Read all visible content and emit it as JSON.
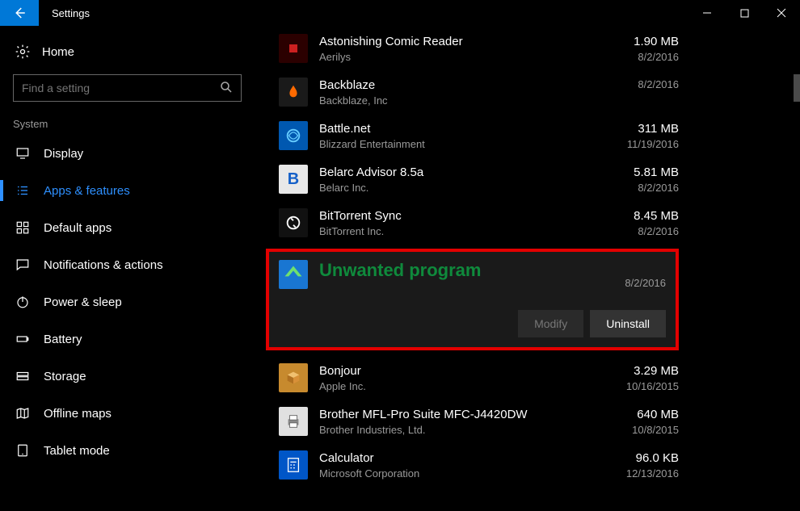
{
  "window": {
    "title": "Settings"
  },
  "sidebar": {
    "home_label": "Home",
    "search_placeholder": "Find a setting",
    "group_label": "System",
    "items": [
      {
        "label": "Display"
      },
      {
        "label": "Apps & features"
      },
      {
        "label": "Default apps"
      },
      {
        "label": "Notifications & actions"
      },
      {
        "label": "Power & sleep"
      },
      {
        "label": "Battery"
      },
      {
        "label": "Storage"
      },
      {
        "label": "Offline maps"
      },
      {
        "label": "Tablet mode"
      }
    ],
    "active_index": 1
  },
  "selected_app": {
    "name": "Unwanted program",
    "date": "8/2/2016",
    "modify_label": "Modify",
    "uninstall_label": "Uninstall"
  },
  "apps_top": [
    {
      "name": "Astonishing Comic Reader",
      "publisher": "Aerilys",
      "size": "1.90 MB",
      "date": "8/2/2016",
      "icon": "ic-red"
    },
    {
      "name": "Backblaze",
      "publisher": "Backblaze, Inc",
      "size": "",
      "date": "8/2/2016",
      "icon": "ic-orange"
    },
    {
      "name": "Battle.net",
      "publisher": "Blizzard Entertainment",
      "size": "311 MB",
      "date": "11/19/2016",
      "icon": "ic-blue"
    },
    {
      "name": "Belarc Advisor 8.5a",
      "publisher": "Belarc Inc.",
      "size": "5.81 MB",
      "date": "8/2/2016",
      "icon": "ic-white"
    },
    {
      "name": "BitTorrent Sync",
      "publisher": "BitTorrent Inc.",
      "size": "8.45 MB",
      "date": "8/2/2016",
      "icon": "ic-dark"
    }
  ],
  "apps_bottom": [
    {
      "name": "Bonjour",
      "publisher": "Apple Inc.",
      "size": "3.29 MB",
      "date": "10/16/2015",
      "icon": "ic-box"
    },
    {
      "name": "Brother MFL-Pro Suite MFC-J4420DW",
      "publisher": "Brother Industries, Ltd.",
      "size": "640 MB",
      "date": "10/8/2015",
      "icon": "ic-prn"
    },
    {
      "name": "Calculator",
      "publisher": "Microsoft Corporation",
      "size": "96.0 KB",
      "date": "12/13/2016",
      "icon": "ic-calc"
    }
  ],
  "truncated_top": {
    "publisher_fragment": "",
    "date_fragment": ""
  }
}
